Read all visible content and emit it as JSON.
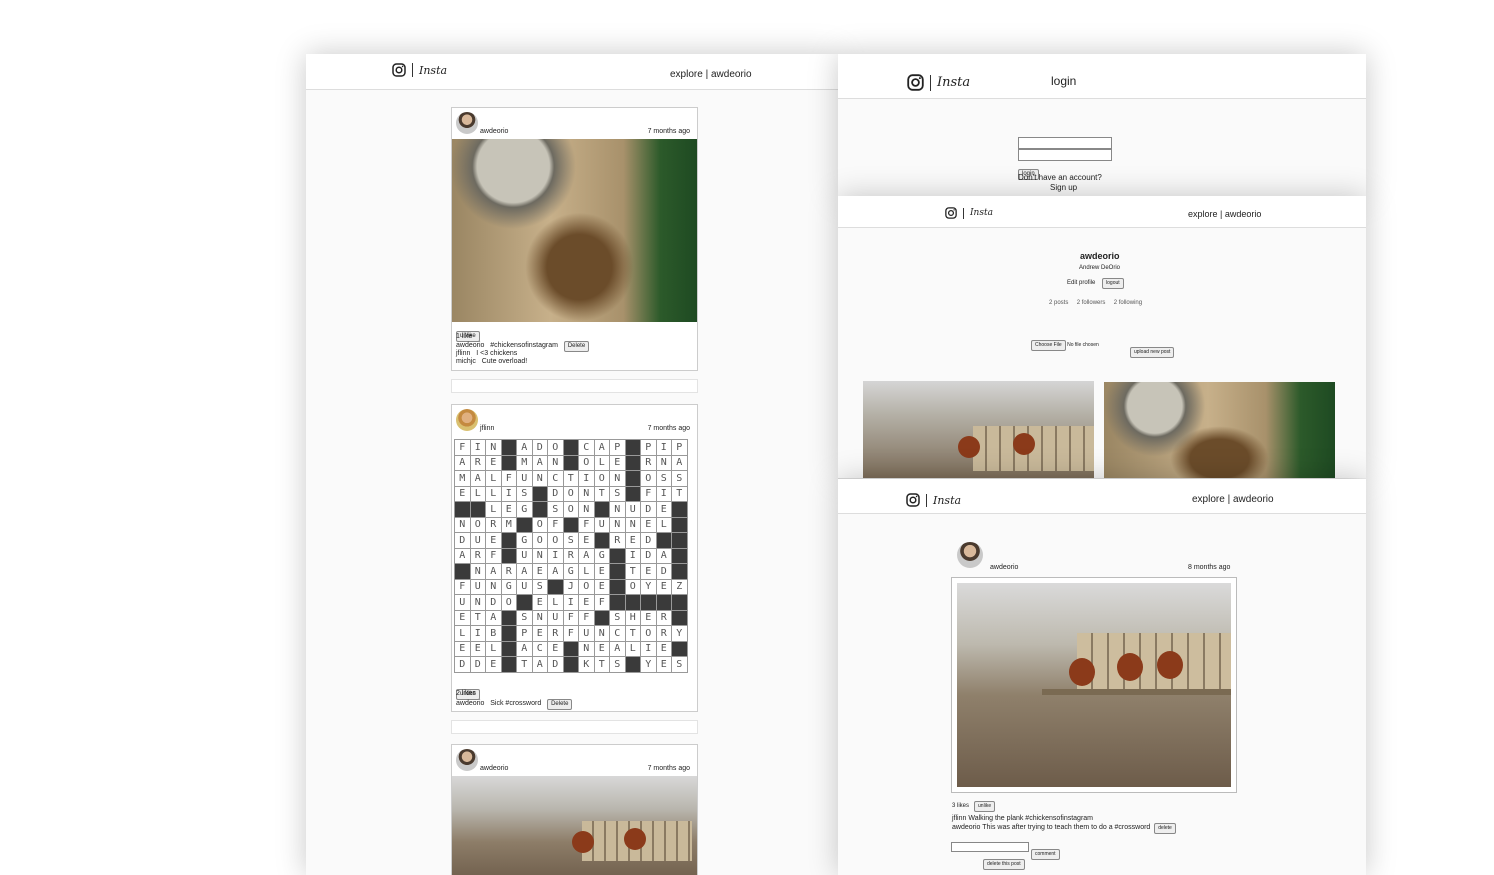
{
  "brand": {
    "name": "Insta",
    "logo_icon": "instagram-camera-icon"
  },
  "feed_window": {
    "nav": {
      "explore": "explore",
      "separator": "|",
      "user": "awdeorio"
    },
    "posts": [
      {
        "owner": "awdeorio",
        "time": "7 months ago",
        "button": "unlike",
        "likes": "1 like",
        "comments": [
          {
            "user": "awdeorio",
            "text": "#chickensofinstagram",
            "delete": "Delete"
          },
          {
            "user": "jflinn",
            "text": "I <3 chickens"
          },
          {
            "user": "michjc",
            "text": "Cute overload!"
          }
        ]
      },
      {
        "owner": "jflinn",
        "time": "7 months ago",
        "button": "unlike",
        "likes": "2 likes",
        "comments": [
          {
            "user": "awdeorio",
            "text": "Sick #crossword",
            "delete": "Delete"
          }
        ]
      },
      {
        "owner": "awdeorio",
        "time": "7 months ago"
      }
    ]
  },
  "login_window": {
    "nav": {
      "login": "login"
    },
    "login_button": "login",
    "no_account": "Don't have an account?",
    "signup": "Sign up"
  },
  "profile_window": {
    "nav": {
      "explore": "explore",
      "separator": "|",
      "user": "awdeorio"
    },
    "username": "awdeorio",
    "fullname": "Andrew DeOrio",
    "edit_profile": "Edit profile",
    "logout": "logout",
    "stats": {
      "posts": "2 posts",
      "followers": "2 followers",
      "following": "2 following"
    },
    "file_button": "Choose File",
    "file_status": "No file chosen",
    "upload": "upload new post"
  },
  "post_window": {
    "nav": {
      "explore": "explore",
      "separator": "|",
      "user": "awdeorio"
    },
    "owner": "awdeorio",
    "time": "8 months ago",
    "likes": "3 likes",
    "button": "unlike",
    "comments": [
      {
        "user": "jflinn",
        "text": "Walking the plank #chickensofinstagram"
      },
      {
        "user": "awdeorio",
        "text": "This was after trying to teach them to do a #crossword",
        "delete": "delete"
      }
    ],
    "comment_button": "comment",
    "delete_post": "delete this post"
  },
  "crossword_rows": [
    "FIN#ADO#CAP#PIP",
    "ARE#MAN#OLE#RNA",
    "MALFUNCTION#OSS",
    "ELLIS#DONTS#FIT",
    "##LEG#SON#NUDE#",
    "NORM#OF#FUNNEL#",
    "DUE#GOOSE#RED##",
    "ARF#UNIRAG#IDA#",
    "#NARAEAGLE#TED#",
    "FUNGUS#JOE#OYEZ",
    "UNDO#ELIEF#####",
    "ETA#SNUFF#SHER#",
    "LIB#PERFUNCTORY",
    "EEL#ACE#NEALIE#",
    "DDE#TAD#KTS#YES"
  ],
  "colors": {
    "page_bg": "#fafafa",
    "header_bg": "#ffffff",
    "border": "#dbdbdb",
    "text": "#222222"
  }
}
